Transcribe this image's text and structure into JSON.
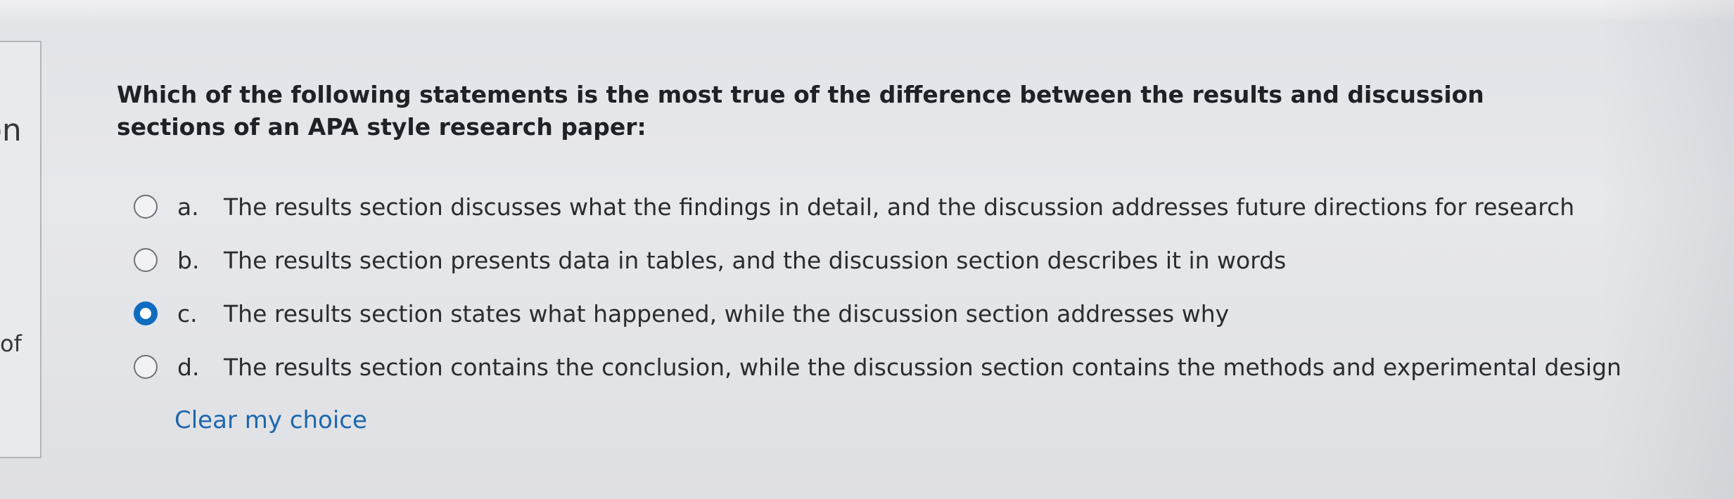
{
  "sidebar": {
    "fragment_top": "on",
    "fragment_mid": "of"
  },
  "question": {
    "text": "Which of the following statements is the most true of the difference between the results and discussion sections of an APA style research paper:"
  },
  "answers": [
    {
      "letter": "a.",
      "text": "The results section discusses what the findings in detail, and the discussion addresses future directions for research",
      "selected": false
    },
    {
      "letter": "b.",
      "text": "The results section presents data in tables, and the discussion section describes it in words",
      "selected": false
    },
    {
      "letter": "c.",
      "text": "The results section states what happened, while the discussion section addresses why",
      "selected": true
    },
    {
      "letter": "d.",
      "text": "The results section contains the conclusion, while the discussion section contains the methods and experimental design",
      "selected": false
    }
  ],
  "clear_choice_label": "Clear my choice",
  "colors": {
    "accent": "#0f6cbf",
    "link": "#1d67ad",
    "background": "#e5e6ea"
  }
}
